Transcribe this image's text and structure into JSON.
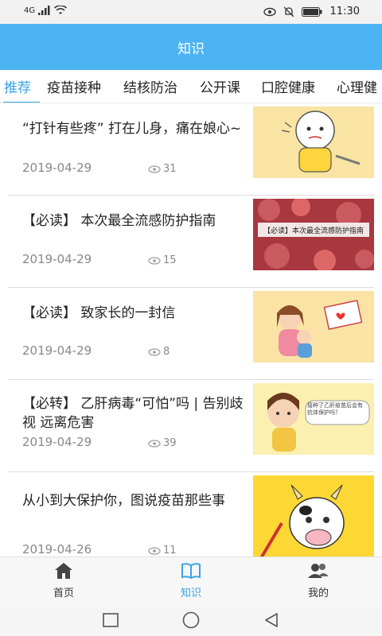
{
  "status_bar": {
    "network": "4G",
    "time": "11:30"
  },
  "header": {
    "title": "知识"
  },
  "tabs": [
    {
      "label": "推荐",
      "active": true
    },
    {
      "label": "疫苗接种"
    },
    {
      "label": "结核防治"
    },
    {
      "label": "公开课"
    },
    {
      "label": "口腔健康"
    },
    {
      "label": "心理健"
    }
  ],
  "articles": [
    {
      "title": "“打针有些疼” 打在儿身，痛在娘心~",
      "date": "2019-04-29",
      "views": "31",
      "thumb_icon": "cartoon-baby-injection-image"
    },
    {
      "title": "【必读】 本次最全流感防护指南",
      "date": "2019-04-29",
      "views": "15",
      "thumb_icon": "flu-virus-image",
      "thumb_caption": "【必读】本次最全流感防护指南"
    },
    {
      "title": "【必读】 致家长的一封信",
      "date": "2019-04-29",
      "views": "8",
      "thumb_icon": "mother-child-letter-image"
    },
    {
      "title": "【必转】 乙肝病毒“可怕”吗 | 告别歧视 远离危害",
      "date": "2019-04-29",
      "views": "39",
      "thumb_icon": "cartoon-girl-question-image",
      "thumb_caption": "接种了乙肝疫苗后会有抗体保护吗？"
    },
    {
      "title": "从小到大保护你，图说疫苗那些事",
      "date": "2019-04-26",
      "views": "11",
      "thumb_icon": "cartoon-cow-vaccine-image"
    }
  ],
  "bottom_nav": [
    {
      "label": "首页",
      "icon": "home-icon"
    },
    {
      "label": "知识",
      "icon": "book-icon",
      "active": true
    },
    {
      "label": "我的",
      "icon": "users-icon"
    }
  ],
  "colors": {
    "accent": "#3aa2e6",
    "header": "#4db4f3"
  }
}
